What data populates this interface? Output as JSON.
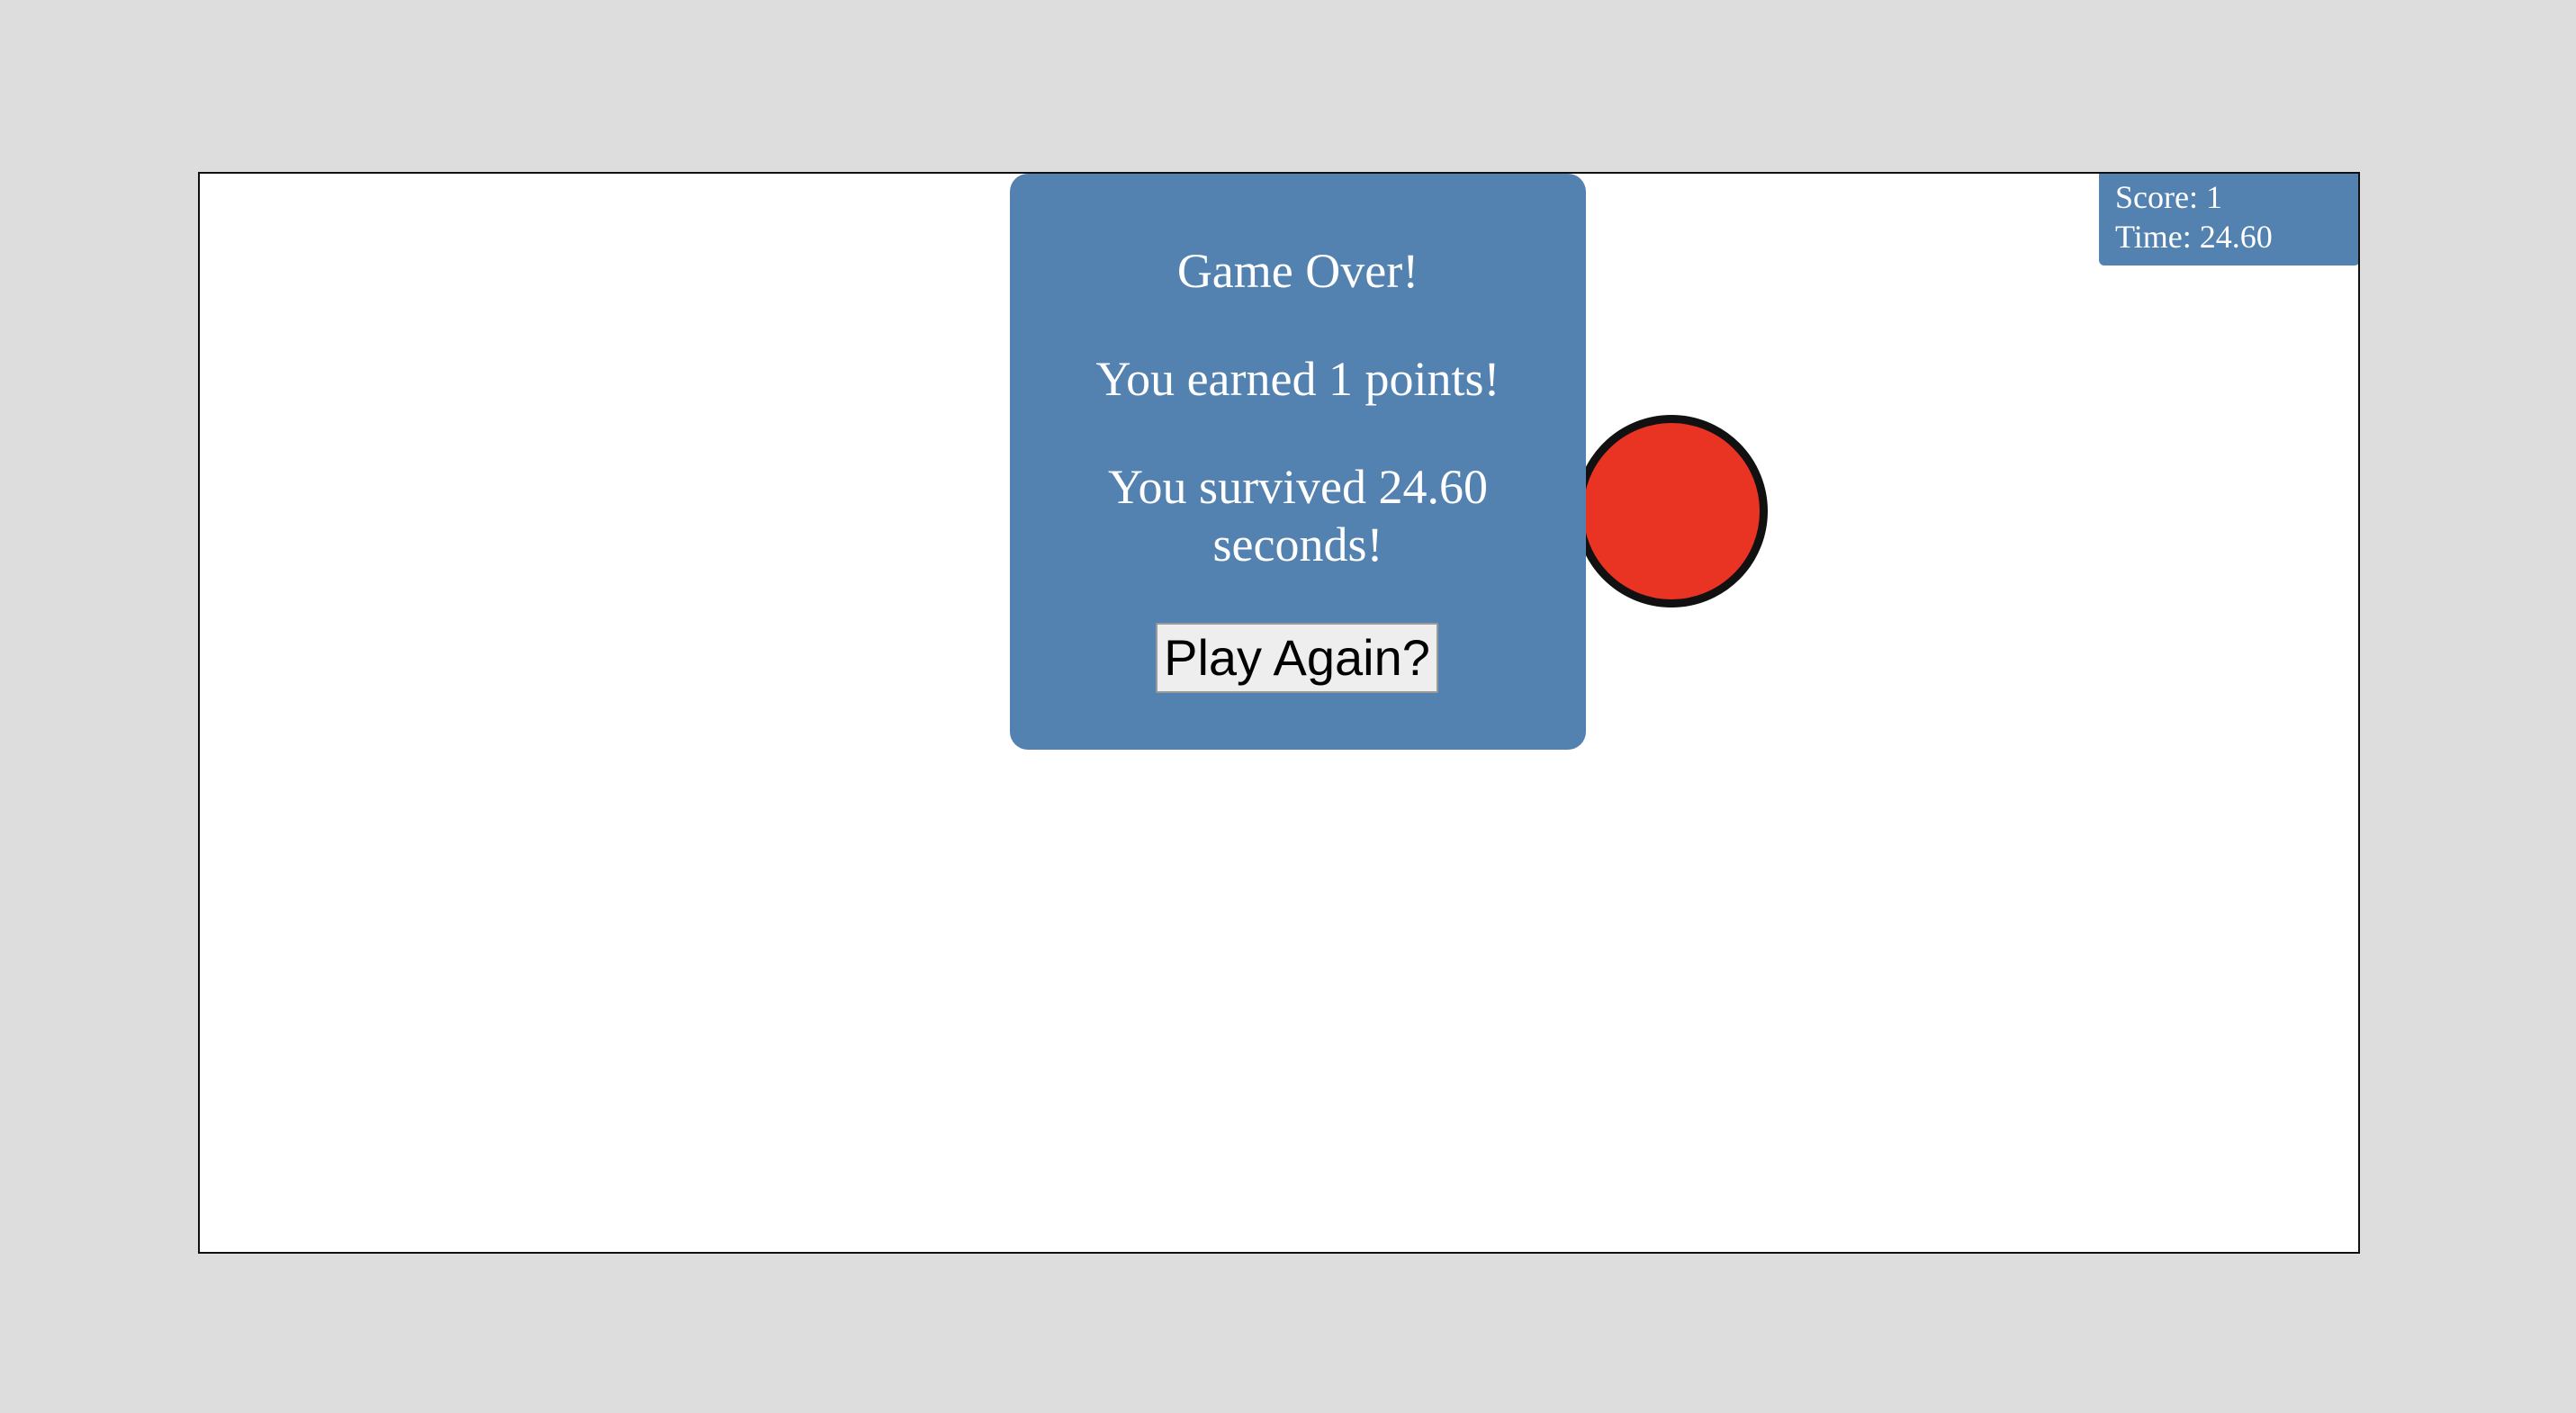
{
  "colors": {
    "background": "#dddddd",
    "panel": "#5382b0",
    "ball_fill": "#e93323",
    "ball_outline": "#111111",
    "text_light": "#ffffff"
  },
  "hud": {
    "score_text": "Score: 1",
    "time_text": "Time: 24.60"
  },
  "modal": {
    "title": "Game Over!",
    "points_text": "You earned 1 points!",
    "survived_text_line1": "You survived 24.60",
    "survived_text_line2": "seconds!",
    "play_again_label": "Play Again?"
  }
}
